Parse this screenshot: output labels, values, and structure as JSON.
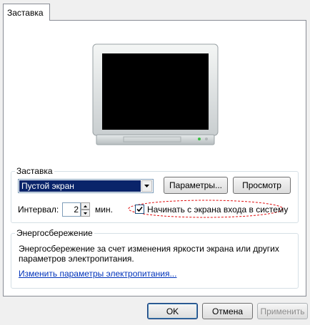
{
  "tab": {
    "label": "Заставка"
  },
  "screensaver_group": {
    "legend": "Заставка",
    "selected": "Пустой экран",
    "settings_label": "Параметры...",
    "preview_label": "Просмотр",
    "interval_label": "Интервал:",
    "interval_value": "2",
    "interval_unit": "мин.",
    "logon_checkbox_label": "Начинать с экрана входа в систему",
    "logon_checked": true
  },
  "power_group": {
    "legend": "Энергосбережение",
    "description_line1": "Энергосбережение за счет изменения яркости экрана или других",
    "description_line2": "параметров электропитания.",
    "link": "Изменить параметры электропитания..."
  },
  "footer": {
    "ok_label": "OK",
    "cancel_label": "Отмена",
    "apply_label": "Применить"
  },
  "colors": {
    "selection": "#0a246a",
    "annotation": "#e01010",
    "link": "#0033bb"
  }
}
